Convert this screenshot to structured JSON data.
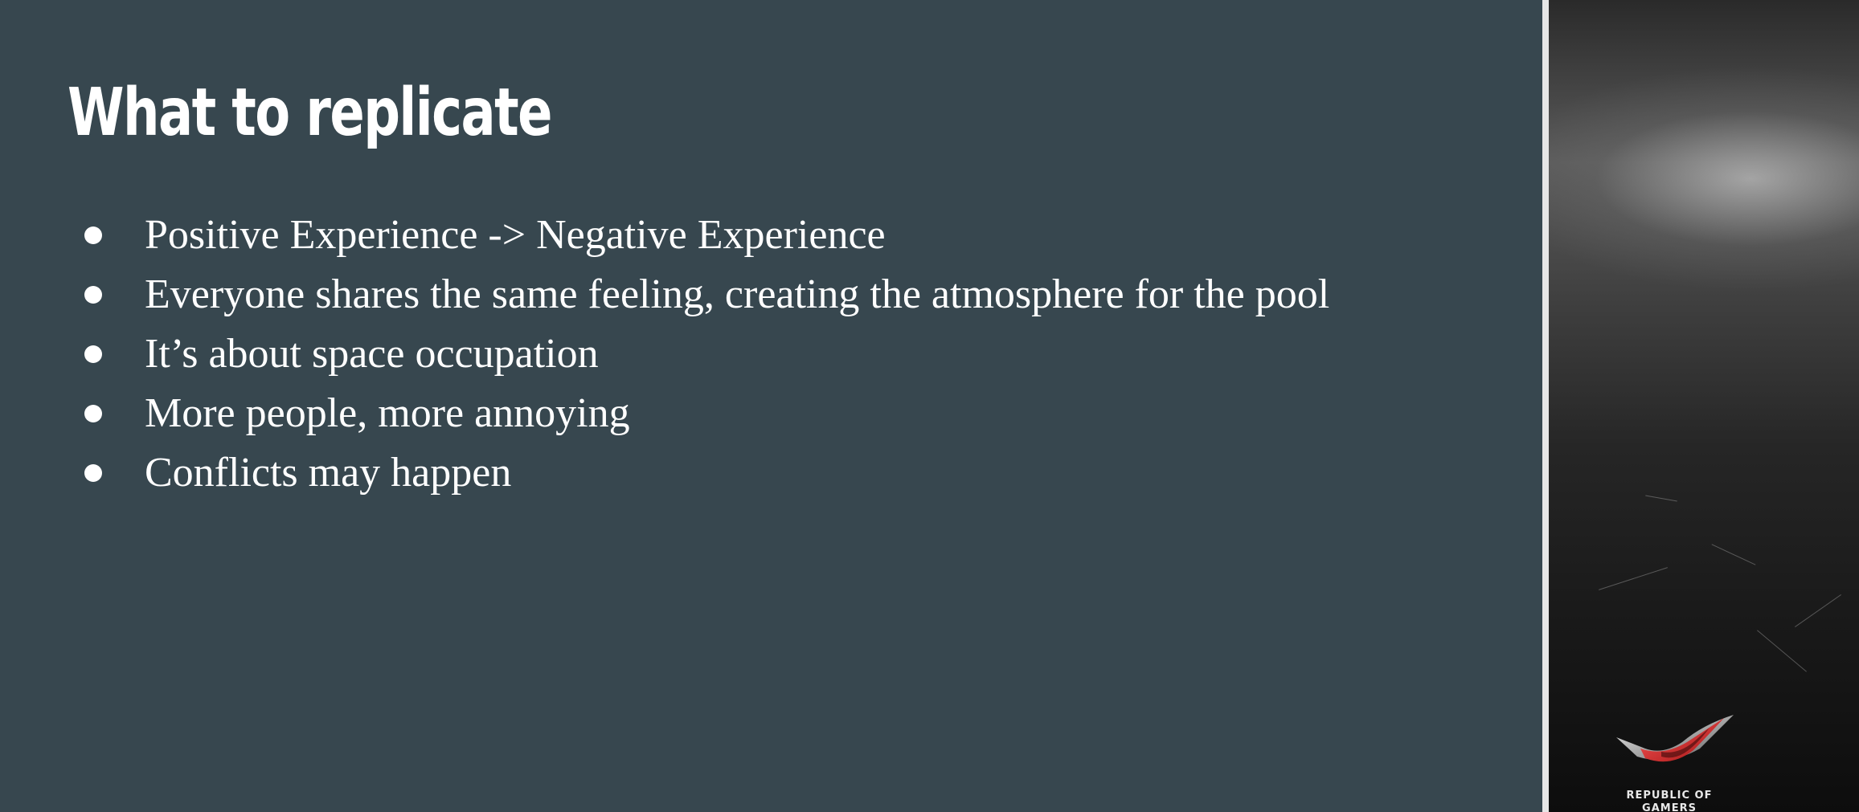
{
  "slide": {
    "title": "What to replicate",
    "bullets": [
      "Positive Experience -> Negative Experience",
      "Everyone shares the same feeling, creating the atmosphere for the pool",
      "It’s about space occupation",
      "More people, more annoying",
      "Conflicts may happen"
    ]
  },
  "side_image": {
    "logo_text_line1": "REPUBLIC OF",
    "logo_text_line2": "GAMERS",
    "logo_icon": "rog-eye-icon"
  },
  "colors": {
    "background": "#37474f",
    "text": "#ffffff",
    "divider": "#e6e6e6",
    "logo_red": "#d42a2a"
  }
}
